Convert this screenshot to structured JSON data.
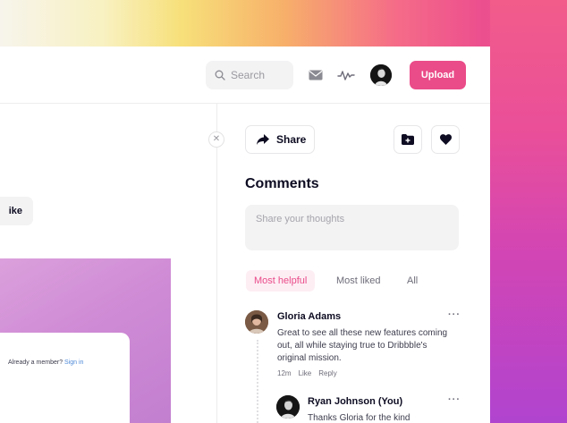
{
  "colors": {
    "accent": "#ea4c89",
    "accent_soft": "#fdeef4",
    "text_primary": "#0d0c22",
    "text_secondary": "#6e6d7a",
    "link": "#4f8ad8"
  },
  "header": {
    "search_placeholder": "Search",
    "icons": [
      "search-icon",
      "mail-icon",
      "activity-icon"
    ],
    "upload_label": "Upload"
  },
  "left_panel": {
    "like_label": "ike",
    "member_text": "Already a member?",
    "sign_in_label": "Sign in"
  },
  "comments_panel": {
    "share_label": "Share",
    "close_icon": "close-icon",
    "action_icons": [
      "share-arrow-icon",
      "folder-plus-icon",
      "heart-icon"
    ],
    "title": "Comments",
    "input_placeholder": "Share your thoughts",
    "tabs": [
      {
        "label": "Most helpful",
        "active": true
      },
      {
        "label": "Most liked",
        "active": false
      },
      {
        "label": "All",
        "active": false
      }
    ],
    "comments": [
      {
        "author": "Gloria Adams",
        "text": "Great to see all these new features coming out, all while staying true to Dribbble's original mission.",
        "time": "12m",
        "like_label": "Like",
        "reply_label": "Reply",
        "more": "···"
      },
      {
        "author": "Ryan Johnson (You)",
        "text": "Thanks Gloria for the kind",
        "more": "···"
      }
    ]
  }
}
